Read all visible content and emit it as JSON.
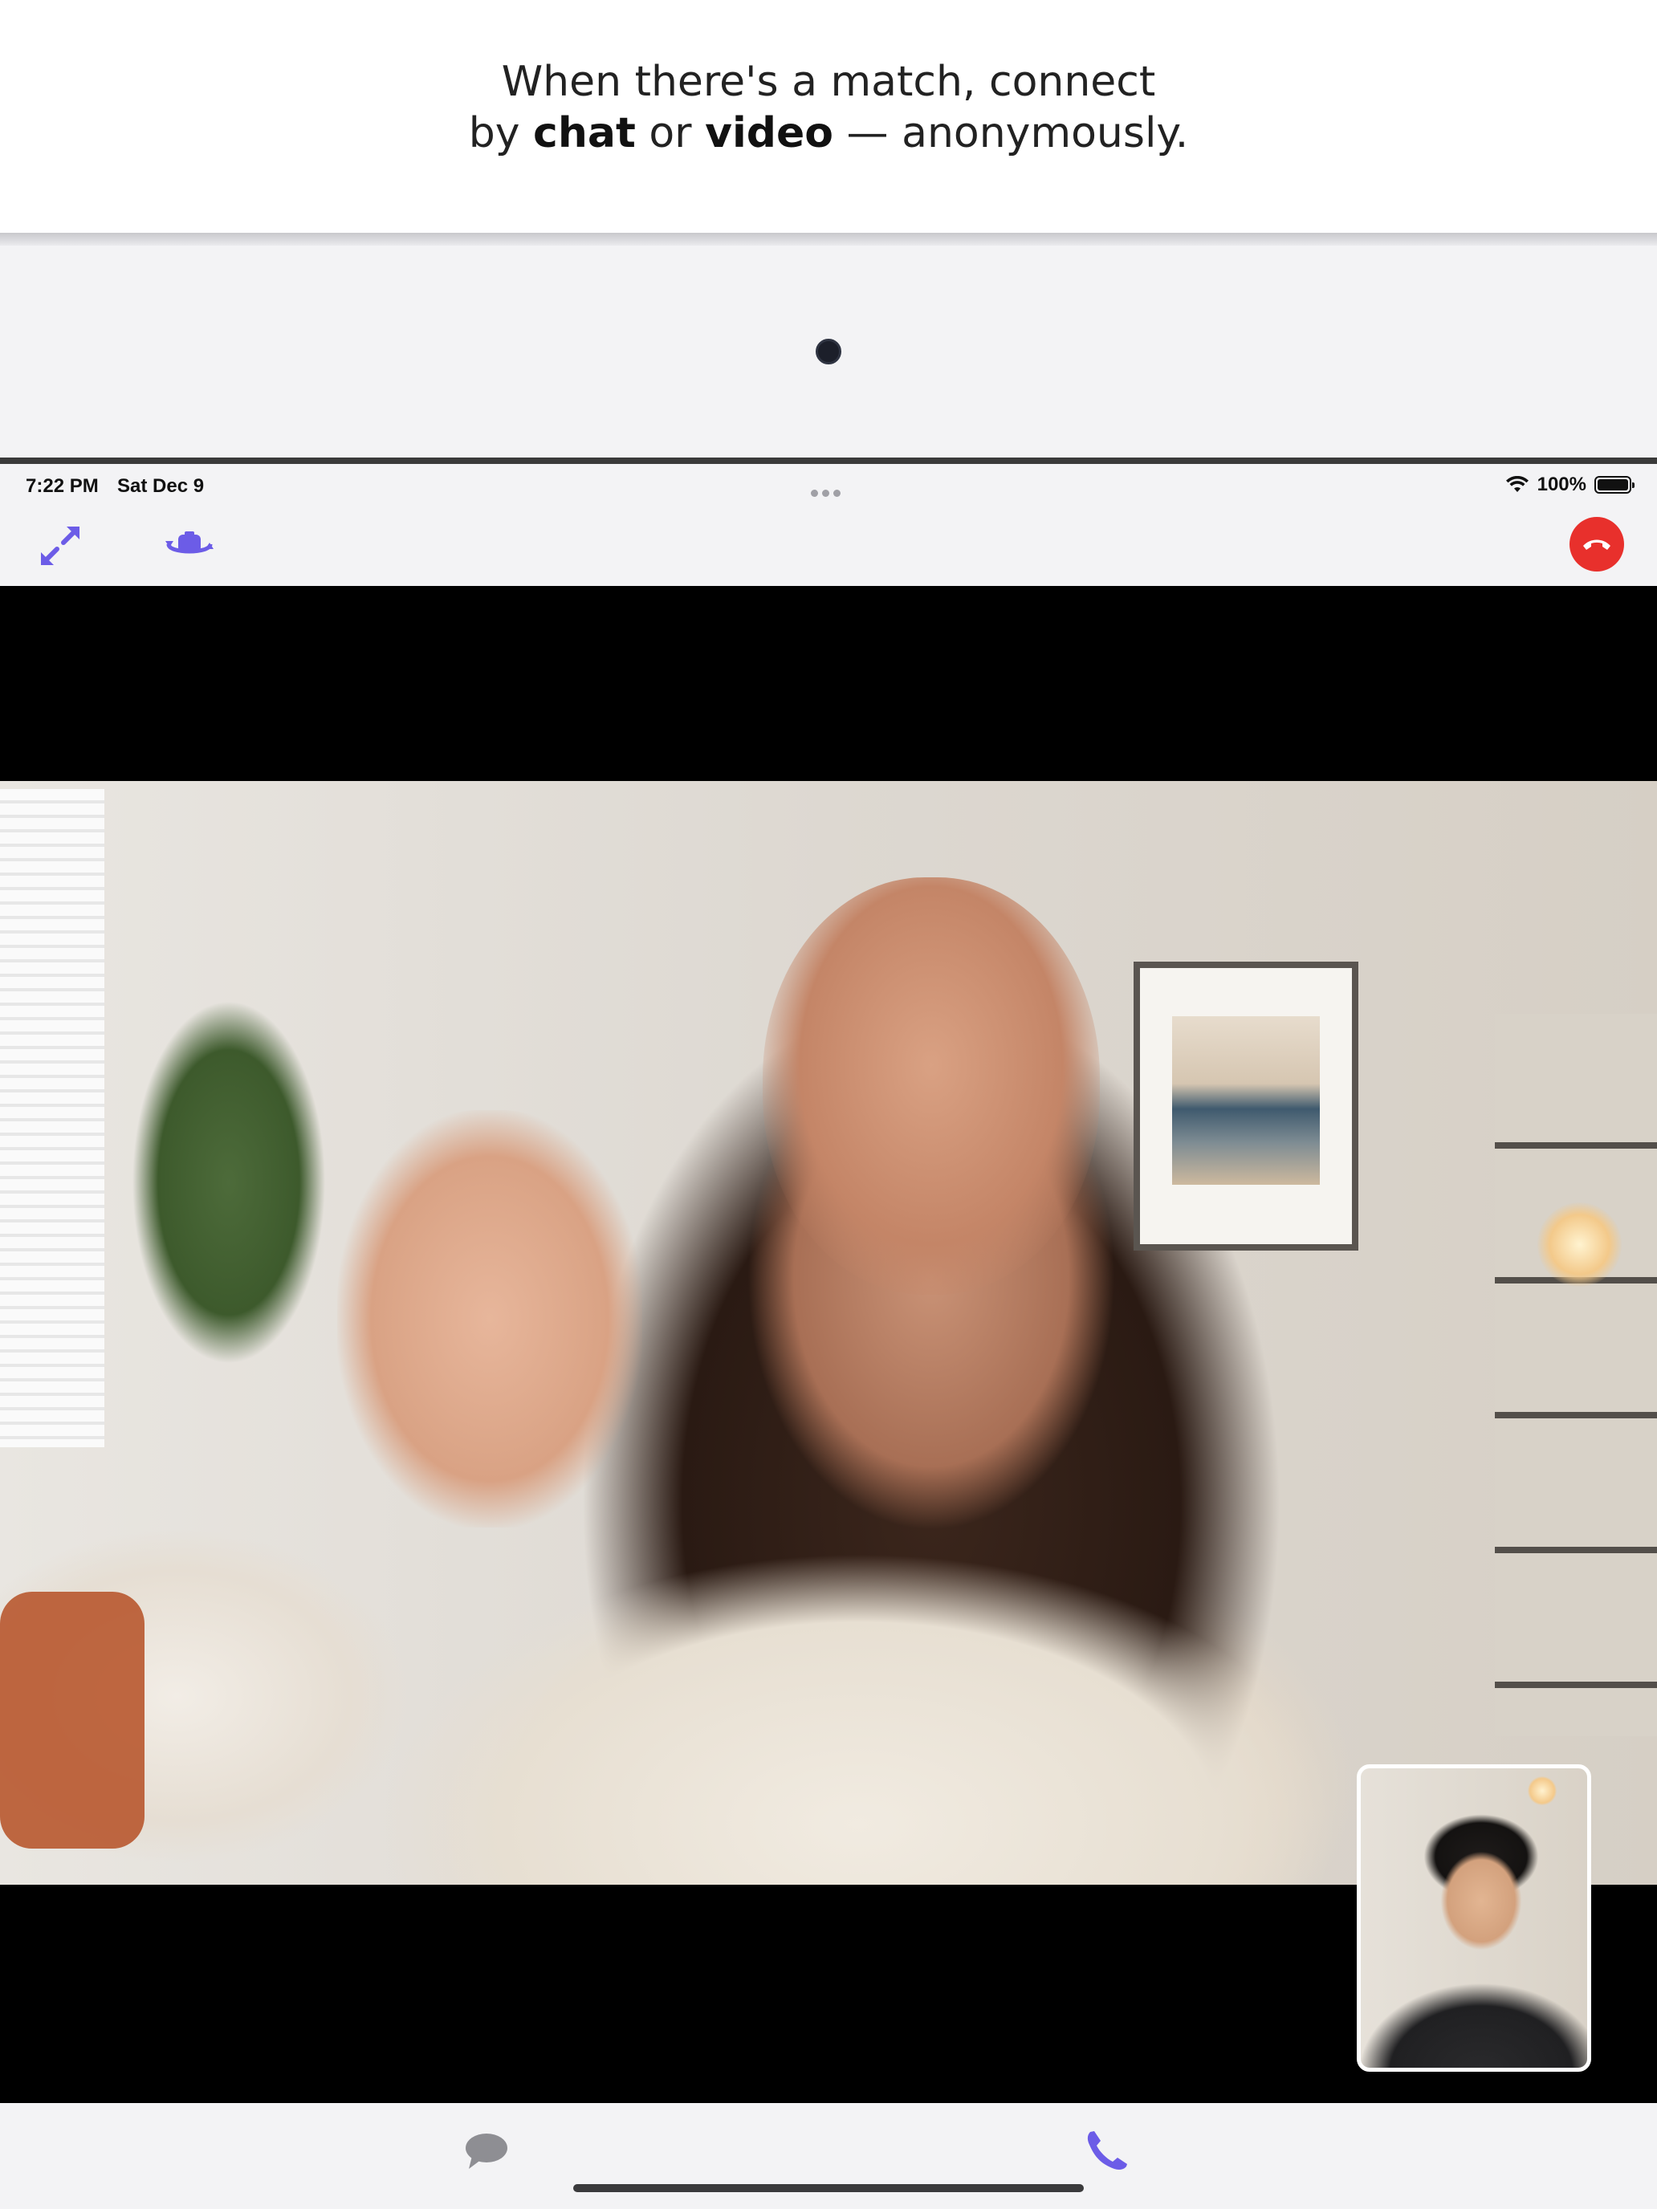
{
  "caption": {
    "line1": "When there's a match, connect",
    "line2_prefix": "by ",
    "line2_chat": "chat",
    "line2_or": " or ",
    "line2_video": "video",
    "line2_suffix": " — anonymously."
  },
  "status_bar": {
    "time": "7:22 PM",
    "date": "Sat Dec 9",
    "battery_percent": "100%",
    "icons": [
      "wifi-icon",
      "battery-icon"
    ]
  },
  "toolbar": {
    "left_icons": [
      "expand-icon",
      "flip-camera-icon"
    ],
    "right_icon": "hang-up-icon",
    "accent_color": "#6c5ce7",
    "hangup_color": "#e8302c"
  },
  "call": {
    "remote_video": "remote-participant-video",
    "self_view": "self-view-video"
  },
  "tab_bar": {
    "items": [
      {
        "icon": "chat-bubble-icon",
        "active": false
      },
      {
        "icon": "phone-icon",
        "active": true
      }
    ],
    "active_color": "#6c5ce7",
    "inactive_color": "#8e8e93"
  }
}
